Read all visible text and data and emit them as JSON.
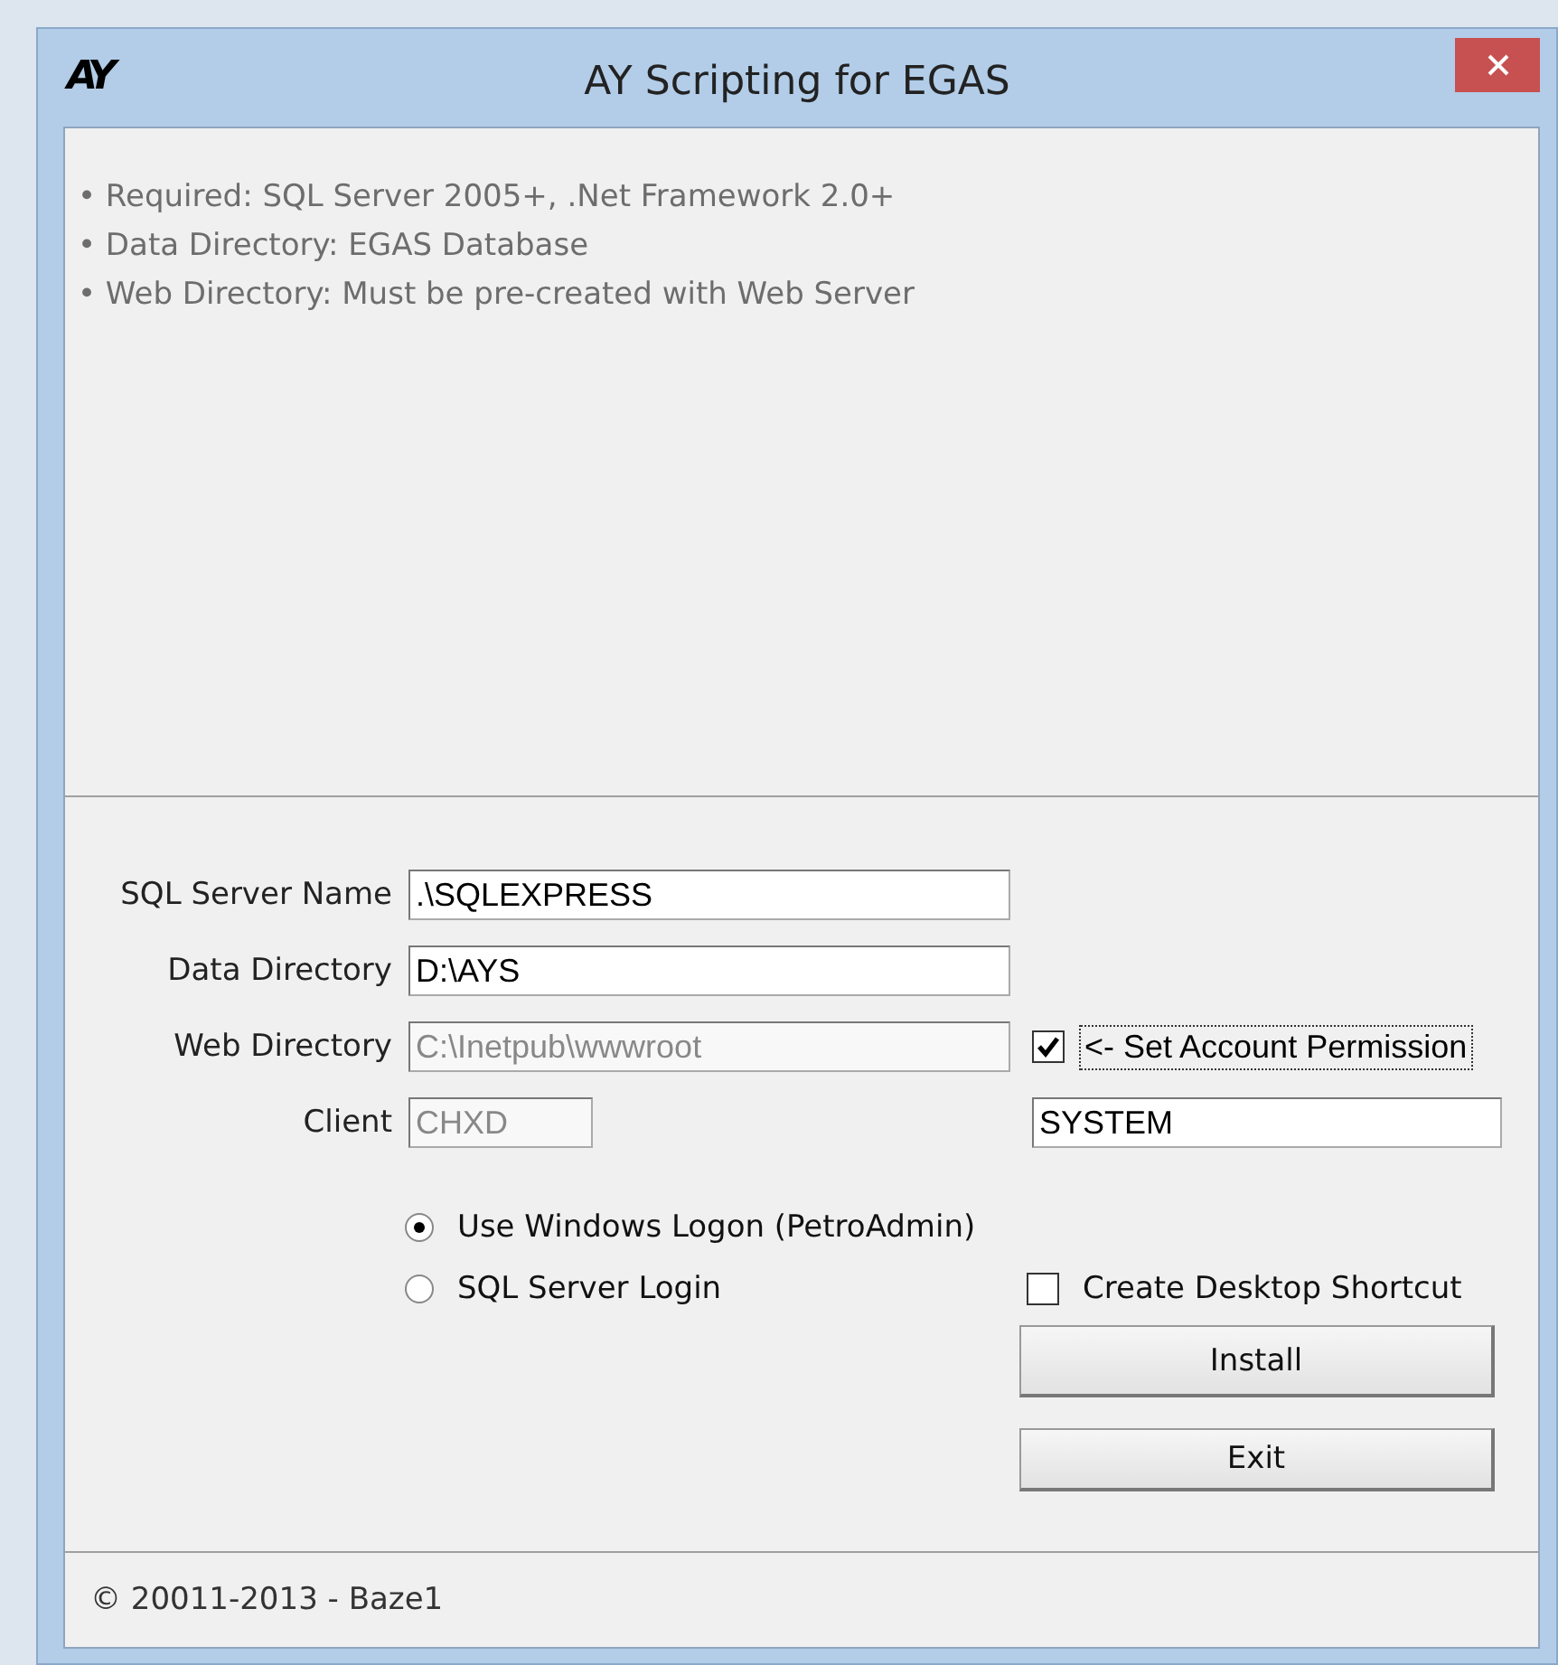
{
  "window": {
    "title": "AY Scripting for EGAS",
    "logo": "AY"
  },
  "info_lines": [
    "• Required: SQL Server 2005+, .Net Framework 2.0+",
    "• Data Directory: EGAS Database",
    "• Web Directory: Must be pre-created with Web Server"
  ],
  "fields": [
    {
      "label": "SQL Server Name",
      "value": ".\\SQLEXPRESS",
      "disabled": false,
      "kind": "wide"
    },
    {
      "label": "Data Directory",
      "value": "D:\\AYS",
      "disabled": false,
      "kind": "wide"
    },
    {
      "label": "Web Directory",
      "value": "C:\\Inetpub\\wwwroot",
      "disabled": true,
      "kind": "wide"
    },
    {
      "label": "Client",
      "value": "CHXD",
      "disabled": true,
      "kind": "short"
    }
  ],
  "permission": {
    "label": "<- Set Account Permission",
    "checked": true,
    "account": "SYSTEM"
  },
  "logon_options": [
    {
      "label": "Use Windows Logon (PetroAdmin)",
      "selected": true
    },
    {
      "label": "SQL Server Login",
      "selected": false
    }
  ],
  "shortcut": {
    "label": "Create Desktop Shortcut",
    "checked": false
  },
  "buttons": [
    "Install",
    "Exit"
  ],
  "footer": "© 20011-2013 - Baze1"
}
